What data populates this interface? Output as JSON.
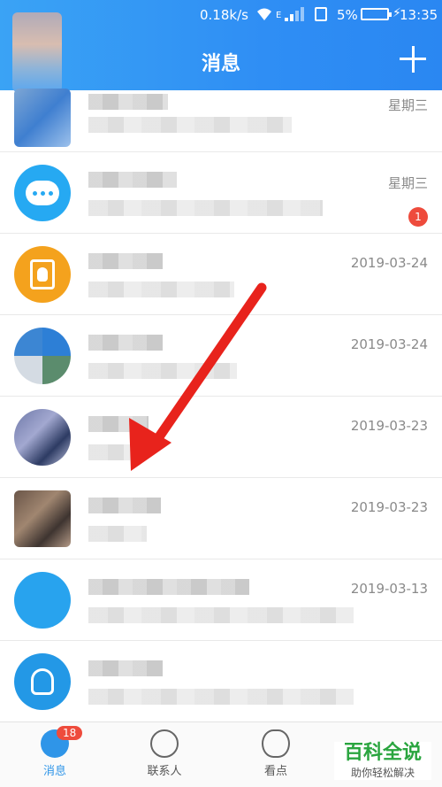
{
  "status_bar": {
    "speed": "0.18k/s",
    "network": "E",
    "battery": "5%",
    "time": "13:35"
  },
  "header": {
    "title": "消息"
  },
  "conversations": [
    {
      "date": "星期三",
      "badge": ""
    },
    {
      "date": "星期三",
      "badge": "1"
    },
    {
      "date": "2019-03-24",
      "badge": ""
    },
    {
      "date": "2019-03-24",
      "badge": ""
    },
    {
      "date": "2019-03-23",
      "badge": ""
    },
    {
      "date": "2019-03-23",
      "badge": ""
    },
    {
      "date": "2019-03-13",
      "badge": ""
    },
    {
      "date": "",
      "badge": ""
    }
  ],
  "nav": {
    "messages": "消息",
    "messages_badge": "18",
    "contacts": "联系人",
    "watch": "看点"
  },
  "watermark": {
    "main": "百科全说",
    "sub": "助你轻松解决"
  },
  "colors": {
    "header": "#2f8ef4",
    "badge": "#ee4b3c",
    "arrow": "#e8231c"
  }
}
